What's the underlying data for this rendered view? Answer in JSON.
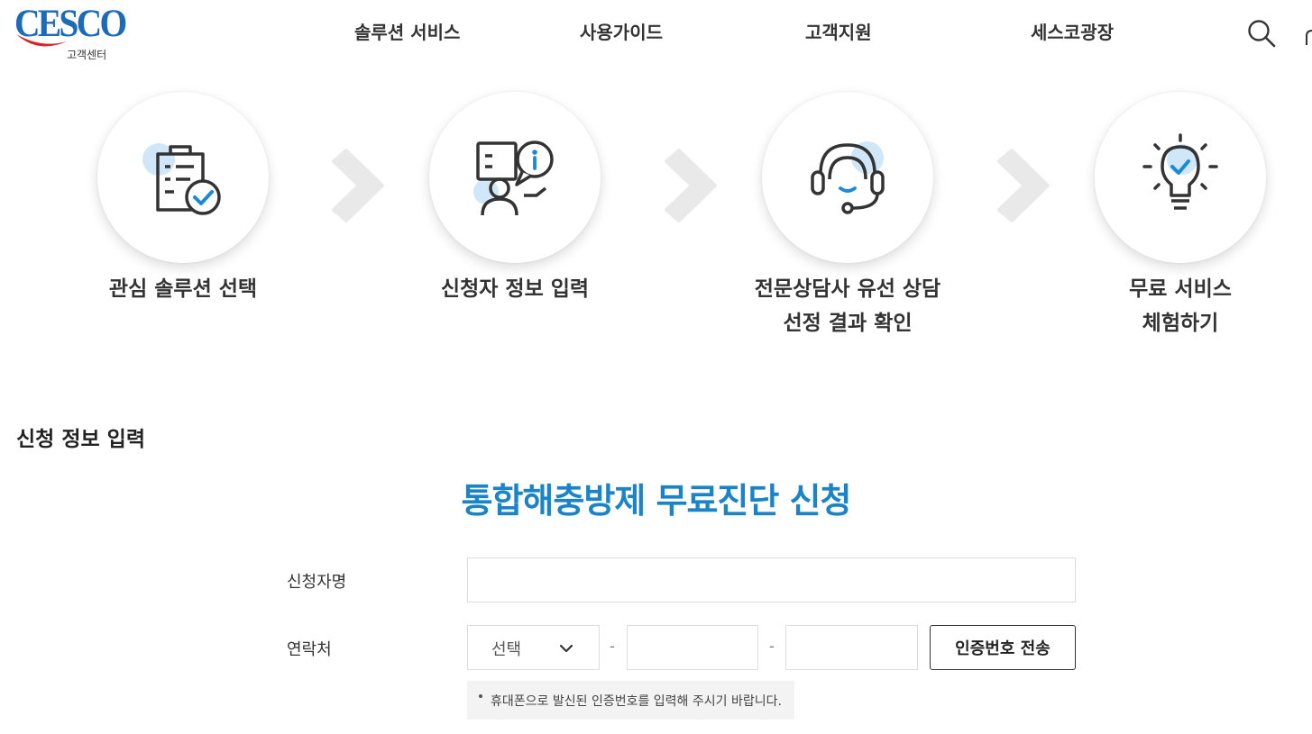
{
  "header": {
    "logo_text": "CESCO",
    "logo_sub": "고객센터",
    "nav": [
      "솔루션 서비스",
      "사용가이드",
      "고객지원",
      "세스코광장"
    ],
    "search_icon": "search-icon"
  },
  "steps": [
    {
      "line1": "관심 솔루션 선택",
      "line2": "",
      "icon": "clipboard-check-icon"
    },
    {
      "line1": "신청자 정보 입력",
      "line2": "",
      "icon": "user-info-icon"
    },
    {
      "line1": "전문상담사 유선 상담",
      "line2": "선정 결과 확인",
      "icon": "headset-icon"
    },
    {
      "line1": "무료 서비스",
      "line2": "체험하기",
      "icon": "lightbulb-check-icon"
    }
  ],
  "colors": {
    "accent": "#1a84c6",
    "icon_highlight": "#cfe7f8",
    "check_blue": "#1a8ad8"
  },
  "form": {
    "section_title": "신청 정보 입력",
    "title": "통합해충방제 무료진단 신청",
    "name_label": "신청자명",
    "name_value": "",
    "phone_label": "연락처",
    "phone_select": "선택",
    "phone_dash": "-",
    "phone_mid": "",
    "phone_last": "",
    "verify_button": "인증번호 전송",
    "notice": "휴대폰으로 발신된 인증번호를 입력해 주시기 바랍니다."
  }
}
